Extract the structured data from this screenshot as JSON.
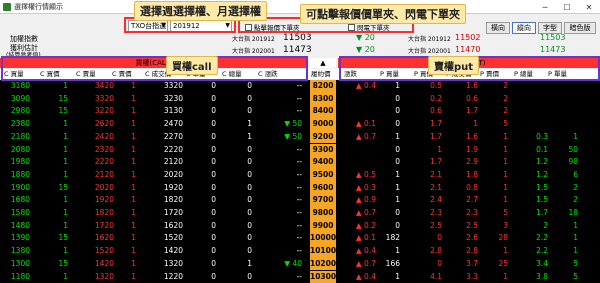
{
  "window": {
    "title": "選擇權行情顯示"
  },
  "toolbar": {
    "product": "TXO台指選",
    "month": "201912",
    "checkbox1": "點擊報價下單夾",
    "checkbox2": "閃電下單夾",
    "buttons": [
      "橫向",
      "縱向",
      "字型",
      "暗色版"
    ]
  },
  "info": {
    "l1": "加權指數",
    "l2": "獲利估計",
    "l3": "(結算參考值)",
    "f1_label": "大台指 201912",
    "f1_value": "11503",
    "f1_chg": "▼ 20",
    "f2_label": "大台指 202001",
    "f2_value": "11473",
    "f2_chg": "▼ 20",
    "r1_label": "大台指 201912",
    "r1_v": "11502",
    "r1_v2": "11503",
    "r2_label": "大台指 202001",
    "r2_v": "11470",
    "r2_v2": "11473"
  },
  "annotations": {
    "a1": "選擇週選擇權、月選擇權",
    "a2": "可點擊報價價單夾、閃電下單夾",
    "a3": "買權call",
    "a4": "賣權put"
  },
  "headers": {
    "call": "買權(CALL)",
    "put": "賣權(PUT)",
    "strike": "履約價",
    "call_cols": [
      "C 買量",
      "C 買價",
      "C 賣量",
      "C 賣價",
      "C 成交價",
      "C 單量",
      "C 總量",
      "C 漲跌"
    ],
    "put_cols": [
      "漲跌",
      "P 買量",
      "P 買價",
      "P 成交價",
      "P 賣價",
      "P 總量",
      "P 單量",
      "P 買價"
    ]
  },
  "colors": {
    "callHeader": "#ff3030",
    "putHeader": "#ff3030",
    "strike": "#f6a623"
  },
  "rows": [
    {
      "c1": "3180",
      "c2": "1",
      "c3": "3420",
      "c4": "1",
      "c5": "3320",
      "c6": "0",
      "c7": "0",
      "c8": "--",
      "k": "8200",
      "p1": "▲ 0.4",
      "p2": "1",
      "p3": "0.5",
      "p4": "1.6",
      "p5": "2",
      "p6": "",
      "p7": ""
    },
    {
      "c1": "3090",
      "c2": "15",
      "c3": "3320",
      "c4": "1",
      "c5": "3230",
      "c6": "0",
      "c7": "0",
      "c8": "--",
      "k": "8300",
      "p1": "",
      "p2": "0",
      "p3": "0.2",
      "p4": "0.6",
      "p5": "2",
      "p6": "",
      "p7": ""
    },
    {
      "c1": "2980",
      "c2": "15",
      "c3": "3220",
      "c4": "1",
      "c5": "3130",
      "c6": "0",
      "c7": "0",
      "c8": "--",
      "k": "8400",
      "p1": "",
      "p2": "0",
      "p3": "0.6",
      "p4": "1.7",
      "p5": "2",
      "p6": "",
      "p7": ""
    },
    {
      "c1": "2380",
      "c2": "1",
      "c3": "2620",
      "c4": "1",
      "c5": "2470",
      "c6": "0",
      "c7": "1",
      "c8": "▼ 50",
      "k": "9000",
      "p1": "▲ 0.1",
      "p2": "0",
      "p3": "1.7",
      "p4": "1",
      "p5": "5",
      "p6": "",
      "p7": ""
    },
    {
      "c1": "2180",
      "c2": "1",
      "c3": "2420",
      "c4": "1",
      "c5": "2270",
      "c6": "0",
      "c7": "1",
      "c8": "▼ 50",
      "k": "9200",
      "p1": "▲ 0.7",
      "p2": "1",
      "p3": "1.7",
      "p4": "1.6",
      "p5": "1",
      "p6": "0.3",
      "p7": "1"
    },
    {
      "c1": "2080",
      "c2": "1",
      "c3": "2320",
      "c4": "1",
      "c5": "2220",
      "c6": "0",
      "c7": "0",
      "c8": "--",
      "k": "9300",
      "p1": "",
      "p2": "0",
      "p3": "1",
      "p4": "1.9",
      "p5": "1",
      "p6": "0.1",
      "p7": "50"
    },
    {
      "c1": "1980",
      "c2": "1",
      "c3": "2220",
      "c4": "1",
      "c5": "2120",
      "c6": "0",
      "c7": "0",
      "c8": "--",
      "k": "9400",
      "p1": "",
      "p2": "0",
      "p3": "1.7",
      "p4": "2.9",
      "p5": "1",
      "p6": "1.2",
      "p7": "98"
    },
    {
      "c1": "1880",
      "c2": "1",
      "c3": "2120",
      "c4": "1",
      "c5": "2020",
      "c6": "0",
      "c7": "0",
      "c8": "--",
      "k": "9500",
      "p1": "▲ 0.5",
      "p2": "1",
      "p3": "2.1",
      "p4": "1.8",
      "p5": "1",
      "p6": "1.2",
      "p7": "6"
    },
    {
      "c1": "1900",
      "c2": "15",
      "c3": "2020",
      "c4": "1",
      "c5": "1920",
      "c6": "0",
      "c7": "0",
      "c8": "--",
      "k": "9600",
      "p1": "▲ 0.3",
      "p2": "1",
      "p3": "2.1",
      "p4": "0.8",
      "p5": "1",
      "p6": "1.5",
      "p7": "2"
    },
    {
      "c1": "1680",
      "c2": "1",
      "c3": "1920",
      "c4": "1",
      "c5": "1820",
      "c6": "0",
      "c7": "0",
      "c8": "--",
      "k": "9700",
      "p1": "▲ 0.9",
      "p2": "1",
      "p3": "2.4",
      "p4": "2.7",
      "p5": "1",
      "p6": "1.5",
      "p7": "2"
    },
    {
      "c1": "1580",
      "c2": "1",
      "c3": "1820",
      "c4": "1",
      "c5": "1720",
      "c6": "0",
      "c7": "0",
      "c8": "--",
      "k": "9800",
      "p1": "▲ 0.7",
      "p2": "0",
      "p3": "2.3",
      "p4": "2.3",
      "p5": "5",
      "p6": "1.7",
      "p7": "18"
    },
    {
      "c1": "1480",
      "c2": "1",
      "c3": "1720",
      "c4": "1",
      "c5": "1620",
      "c6": "0",
      "c7": "0",
      "c8": "--",
      "k": "9900",
      "p1": "▲ 0.2",
      "p2": "0",
      "p3": "2.5",
      "p4": "2.5",
      "p5": "3",
      "p6": "2",
      "p7": "1"
    },
    {
      "c1": "1390",
      "c2": "15",
      "c3": "1620",
      "c4": "1",
      "c5": "1520",
      "c6": "0",
      "c7": "0",
      "c8": "--",
      "k": "10000",
      "p1": "▲ 0.1",
      "p2": "182",
      "p3": "0",
      "p4": "2.6",
      "p5": "28",
      "p6": "2.2",
      "p7": "1"
    },
    {
      "c1": "1380",
      "c2": "1",
      "c3": "1520",
      "c4": "1",
      "c5": "1420",
      "c6": "0",
      "c7": "0",
      "c8": "--",
      "k": "10100",
      "p1": "▲ 0.4",
      "p2": "1",
      "p3": "2.8",
      "p4": "2.8",
      "p5": "1",
      "p6": "2.2",
      "p7": "1"
    },
    {
      "c1": "1300",
      "c2": "15",
      "c3": "1420",
      "c4": "1",
      "c5": "1320",
      "c6": "0",
      "c7": "1",
      "c8": "▼ 40",
      "k": "10200",
      "p1": "▲ 0.7",
      "p2": "166",
      "p3": "0",
      "p4": "3.7",
      "p5": "25",
      "p6": "3.4",
      "p7": "5"
    },
    {
      "c1": "1180",
      "c2": "1",
      "c3": "1320",
      "c4": "1",
      "c5": "1220",
      "c6": "0",
      "c7": "0",
      "c8": "--",
      "k": "10300",
      "p1": "▲ 0.4",
      "p2": "1",
      "p3": "4.1",
      "p4": "3.3",
      "p5": "1",
      "p6": "3.8",
      "p7": "5"
    }
  ]
}
